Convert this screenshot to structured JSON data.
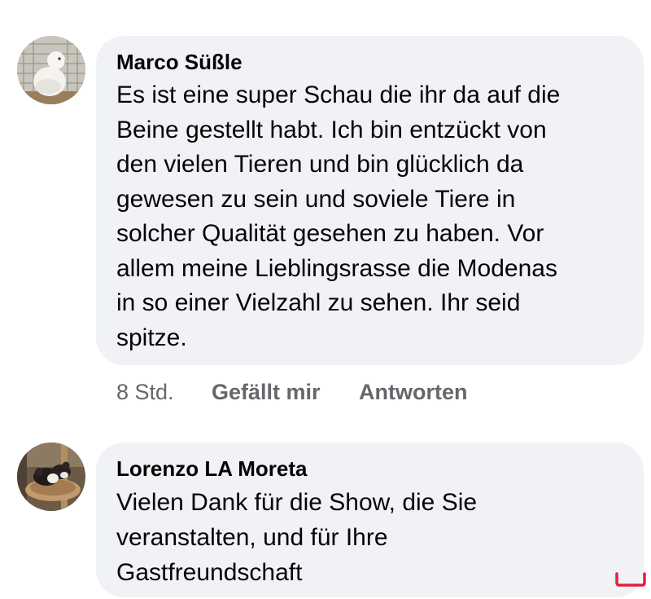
{
  "comments": [
    {
      "author": "Marco Süßle",
      "avatar_icon": "pigeon-avatar",
      "lines": [
        "Es ist eine super Schau die ihr da auf die",
        "Beine gestellt habt. Ich bin entzückt von",
        "den vielen Tieren und bin glücklich da",
        "gewesen zu sein und soviele Tiere in",
        "solcher Qualität gesehen zu haben. Vor",
        "allem meine Lieblingsrasse die Modenas",
        "in so einer Vielzahl zu sehen. Ihr seid",
        "spitze."
      ],
      "time": "8 Std.",
      "like_label": "Gefällt mir",
      "reply_label": "Antworten"
    },
    {
      "author": "Lorenzo LA Moreta",
      "avatar_icon": "pigeons-in-nest-avatar",
      "lines": [
        "Vielen Dank für die Show, die Sie",
        "veranstalten, und für Ihre",
        "Gastfreundschaft"
      ]
    }
  ],
  "colors": {
    "bubble": "#f0f2f5",
    "text": "#050505",
    "meta": "#65676b",
    "corner_mark": "#e41e3f"
  }
}
